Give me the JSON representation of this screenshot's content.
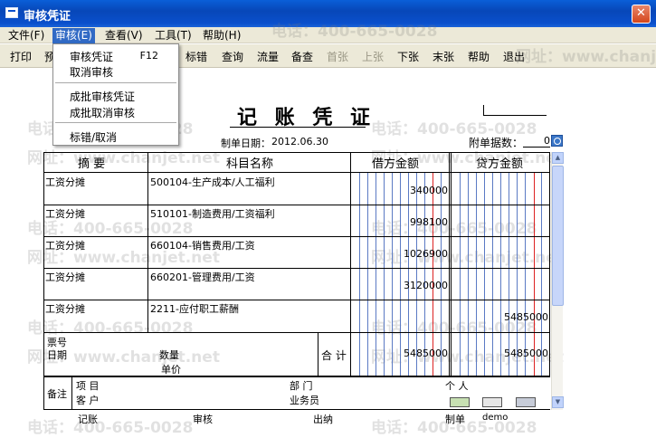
{
  "window": {
    "title": "审核凭证"
  },
  "menubar": [
    {
      "label": "文件(F)"
    },
    {
      "label": "审核(E)"
    },
    {
      "label": "查看(V)"
    },
    {
      "label": "工具(T)"
    },
    {
      "label": "帮助(H)"
    }
  ],
  "toolbar": {
    "print": "打印",
    "preview": "预",
    "mark_error": "标错",
    "query": "查询",
    "flow": "流量",
    "note": "备查",
    "first": "首张",
    "prev": "上张",
    "next": "下张",
    "last": "末张",
    "help": "帮助",
    "exit": "退出"
  },
  "dropdown": {
    "items": [
      {
        "label": "审核凭证",
        "shortcut": "F12"
      },
      {
        "label": "取消审核"
      },
      {
        "label": "成批审核凭证"
      },
      {
        "label": "成批取消审核"
      },
      {
        "label": "标错/取消"
      }
    ]
  },
  "voucher": {
    "title": "记 账 凭 证",
    "date_label": "制单日期：",
    "date": "2012.06.30",
    "attachments_label": "附单据数：",
    "attachments": "0",
    "headers": {
      "summary": "摘  要",
      "account": "科目名称",
      "debit": "借方金额",
      "credit": "贷方金额"
    },
    "rows": [
      {
        "summary": "工资分摊",
        "account": "500104-生产成本/人工福利",
        "debit": "340000",
        "credit": ""
      },
      {
        "summary": "工资分摊",
        "account": "510101-制造费用/工资福利",
        "debit": "998100",
        "credit": ""
      },
      {
        "summary": "工资分摊",
        "account": "660104-销售费用/工资",
        "debit": "1026900",
        "credit": ""
      },
      {
        "summary": "工资分摊",
        "account": "660201-管理费用/工资",
        "debit": "3120000",
        "credit": ""
      },
      {
        "summary": "工资分摊",
        "account": "2211-应付职工薪酬",
        "debit": "",
        "credit": "5485000"
      }
    ],
    "footer": {
      "ticket_no": "票号",
      "date": "日期",
      "quantity": "数量",
      "unit_price": "单价",
      "total_label": "合 计",
      "total_debit": "5485000",
      "total_credit": "5485000"
    },
    "remarks": {
      "label": "备注",
      "project": "项  目",
      "customer": "客  户",
      "department": "部  门",
      "salesperson": "业务员",
      "individual": "个  人"
    },
    "signatures": {
      "bookkeeper": "记账",
      "auditor": "审核",
      "cashier": "出纳",
      "maker_label": "制单",
      "maker": "demo"
    }
  },
  "watermarks": {
    "phone": "电话：400-665-0028",
    "site": "网址：www.chanjet.net"
  }
}
